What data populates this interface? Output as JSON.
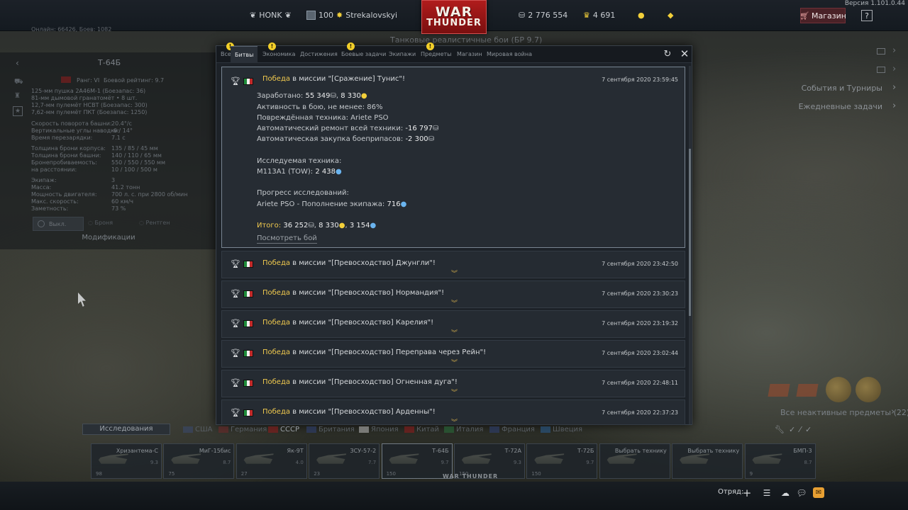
{
  "topbar": {
    "version": "Версия 1.101.0.44",
    "squad_tag": "HONK",
    "level": "100",
    "username": "Strekalovskyi",
    "silver_lions": "2 776 554",
    "eagles": "4 691",
    "logo_line1": "WAR",
    "logo_line2": "THUNDER",
    "shop_label": "Магазин",
    "help_label": "?"
  },
  "left_panel": {
    "online": "Онлайн: 66426, Боев: 1082",
    "vehicle_title": "Т-64Б",
    "rank": "Ранг: VI",
    "battle_rating": "Боевой рейтинг: 9.7",
    "weapons": [
      "125-мм пушка 2А46М-1 (Боезапас: 36)",
      "81-мм дымовой гранатомёт • 8 шт.",
      "12,7-мм пулемёт НСВТ (Боезапас: 300)",
      "7,62-мм пулемёт ПКТ (Боезапас: 1250)"
    ],
    "stats": [
      {
        "label": "Скорость поворота башни:",
        "value": "20.4°/с"
      },
      {
        "label": "Вертикальные углы наводки:",
        "value": "-6 / 14°"
      },
      {
        "label": "Время перезарядки:",
        "value": "7.1 с"
      },
      {
        "label": "Толщина брони корпуса:",
        "value": "135 / 85 / 45 мм"
      },
      {
        "label": "Толщина брони башни:",
        "value": "140 / 110 / 65 мм"
      },
      {
        "label": "Бронепробиваемость:",
        "value": "550 / 550 / 550 мм"
      },
      {
        "label": "на расстоянии:",
        "value": "10 / 100 / 500 м"
      },
      {
        "label": "Экипаж:",
        "value": "3"
      },
      {
        "label": "Масса:",
        "value": "41.2 тонн"
      },
      {
        "label": "Мощность двигателя:",
        "value": "700 л. с. при 2800 об/мин"
      },
      {
        "label": "Макс. скорость:",
        "value": "60 км/ч"
      },
      {
        "label": "Заметность:",
        "value": "73 %"
      }
    ],
    "view_modes": [
      "Выкл.",
      "Броня",
      "Рентген"
    ],
    "modifications": "Модификации"
  },
  "right_panel": {
    "events": "События и Турниры",
    "daily": "Ежедневные задачи",
    "inactive_items": "Все неактивные предметы (22)",
    "battle_mode_hint": "Танковые реалистичные бои (БР 9.7)"
  },
  "dialog": {
    "tabs": [
      {
        "label": "Все",
        "warn": true
      },
      {
        "label": "Битвы",
        "warn": false,
        "active": true
      },
      {
        "label": "Экономика",
        "warn": true
      },
      {
        "label": "Достижения",
        "warn": false
      },
      {
        "label": "Боевые задачи",
        "warn": true
      },
      {
        "label": "Экипажи",
        "warn": false
      },
      {
        "label": "Предметы",
        "warn": true
      },
      {
        "label": "Магазин",
        "warn": false
      },
      {
        "label": "Мировая война",
        "warn": false
      }
    ],
    "warn_glyph": "!",
    "refresh_icon": "↻",
    "close_icon": "✕",
    "expanded": {
      "victory": "Победа",
      "mission": " в миссии \"[Сражение] Тунис\"!",
      "date": "7 сентября 2020 23:59:45",
      "earned_label": "Заработано:",
      "earned_lions": "55 349",
      "earned_rp": "8 330",
      "activity": "Активность в бою, не менее: 86%",
      "damaged": "Повреждённая техника: Ariete PSO",
      "repair_label": "Автоматический ремонт всей техники:",
      "repair_value": "-16 797",
      "ammo_label": "Автоматическая закупка боеприпасов:",
      "ammo_value": "-2 300",
      "research_title": "Исследуемая техника:",
      "research_vehicle": "M113A1 (TOW):",
      "research_value": "2 438",
      "progress_title": "Прогресс исследований:",
      "progress_item": "Ariete PSO - Пополнение экипажа:",
      "progress_value": "716",
      "total_label": "Итого:",
      "total_lions": "36 252",
      "total_rp": "8 330",
      "total_research": "3 154",
      "view_battle": "Посмотреть бой"
    },
    "battles": [
      {
        "victory": "Победа",
        "mission": " в миссии \"[Превосходство] Джунгли\"!",
        "date": "7 сентября 2020 23:42:50"
      },
      {
        "victory": "Победа",
        "mission": " в миссии \"[Превосходство] Нормандия\"!",
        "date": "7 сентября 2020 23:30:23"
      },
      {
        "victory": "Победа",
        "mission": " в миссии \"[Превосходство] Карелия\"!",
        "date": "7 сентября 2020 23:19:32"
      },
      {
        "victory": "Победа",
        "mission": " в миссии \"[Превосходство] Переправа через Рейн\"!",
        "date": "7 сентября 2020 23:02:44"
      },
      {
        "victory": "Победа",
        "mission": " в миссии \"[Превосходство] Огненная дуга\"!",
        "date": "7 сентября 2020 22:48:11"
      },
      {
        "victory": "Победа",
        "mission": " в миссии \"[Превосходство] Арденны\"!",
        "date": "7 сентября 2020 22:37:23"
      }
    ]
  },
  "bottom": {
    "research_tab": "Исследования",
    "nations": [
      "США",
      "Германия",
      "СССР",
      "Британия",
      "Япония",
      "Китай",
      "Италия",
      "Франция",
      "Швеция"
    ],
    "vehicles": [
      {
        "name": "Хризантема-С",
        "br": "9.3",
        "count": "98"
      },
      {
        "name": "МиГ-15бис",
        "br": "8.7",
        "count": "75"
      },
      {
        "name": "Як-9Т",
        "br": "4.0",
        "count": "27"
      },
      {
        "name": "ЗСУ-57-2",
        "br": "7.7",
        "count": "23"
      },
      {
        "name": "Т-64Б",
        "br": "9.7",
        "count": "150"
      },
      {
        "name": "Т-72А",
        "br": "9.3",
        "count": "150"
      },
      {
        "name": "Т-72Б",
        "br": "9.7",
        "count": "150"
      },
      {
        "name": "Выбрать технику",
        "br": "",
        "count": ""
      },
      {
        "name": "Выбрать технику",
        "br": "",
        "count": ""
      },
      {
        "name": "БМП-3",
        "br": "8.7",
        "count": "9"
      }
    ],
    "squad_label": "Отряд:",
    "bottom_logo": "WAR THUNDER"
  },
  "colors": {
    "accent_gold": "#f0c94e",
    "research_blue": "#6ab4ef",
    "rp_yellow": "#f2cf3a",
    "shop_red": "#4a2227"
  },
  "icons": {
    "lions": "silver-lions-icon",
    "rp": "rp-bulb-icon",
    "research": "research-drop-icon",
    "cup": "trophy-cup-icon"
  }
}
